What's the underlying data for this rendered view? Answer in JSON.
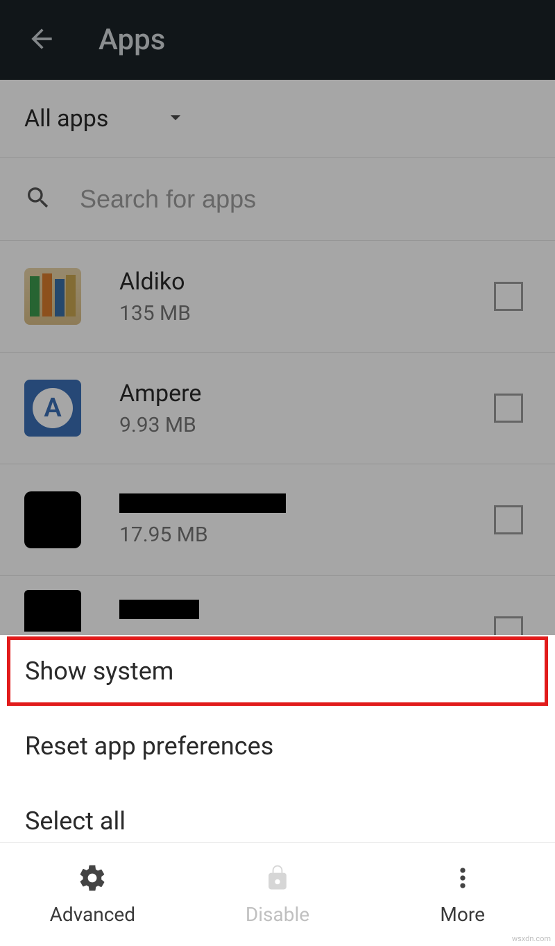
{
  "header": {
    "title": "Apps"
  },
  "filter": {
    "label": "All apps"
  },
  "search": {
    "placeholder": "Search for apps"
  },
  "apps": [
    {
      "name": "Aldiko",
      "size": "135 MB"
    },
    {
      "name": "Ampere",
      "size": "9.93 MB"
    },
    {
      "name": "",
      "size": "17.95 MB"
    },
    {
      "name": "",
      "size": ""
    }
  ],
  "menu": {
    "show_system": "Show system",
    "reset_prefs": "Reset app preferences",
    "select_all": "Select all"
  },
  "bottom": {
    "advanced": "Advanced",
    "disable": "Disable",
    "more": "More"
  },
  "watermark": "wsxdn.com"
}
